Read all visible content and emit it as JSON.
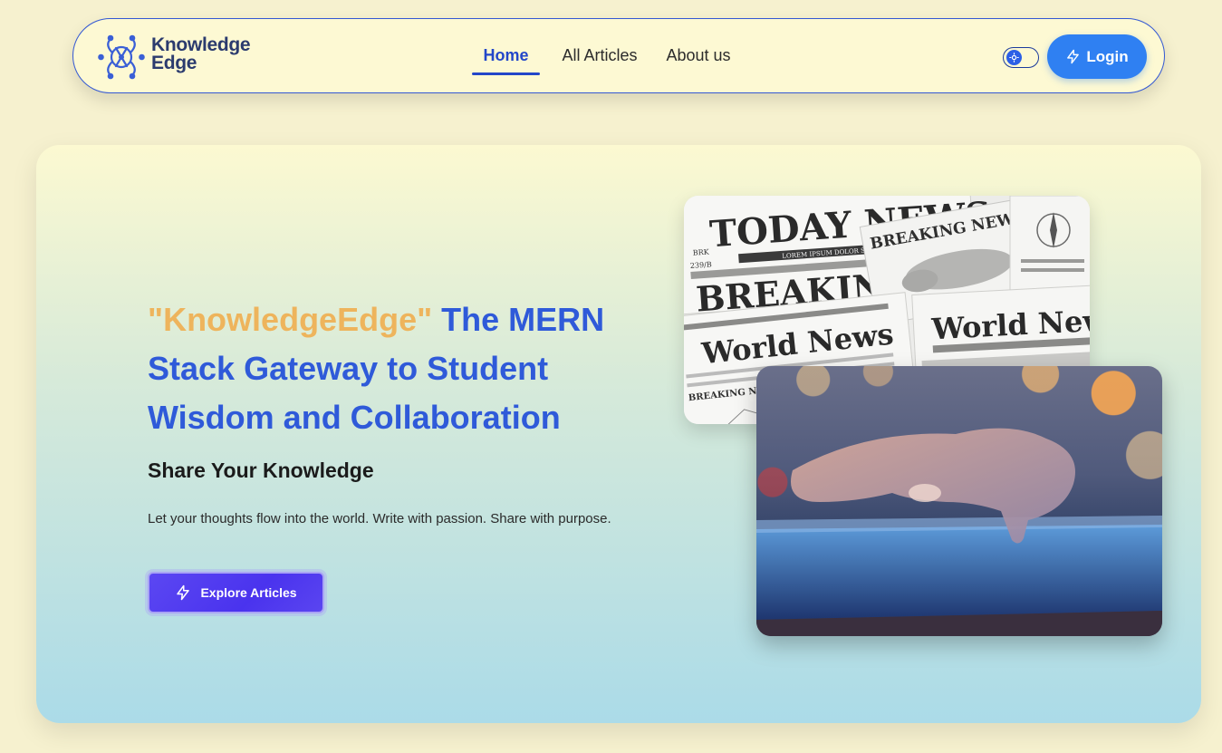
{
  "brand": {
    "line1": "Knowledge",
    "line2": "Edge",
    "logo_icon": "network-people-icon",
    "color": "#2b3b6e"
  },
  "nav": {
    "items": [
      {
        "label": "Home",
        "active": true
      },
      {
        "label": "All Articles",
        "active": false
      },
      {
        "label": "About us",
        "active": false
      }
    ],
    "active_color": "#2347c9"
  },
  "header_actions": {
    "theme_toggle_icon": "sun-icon",
    "login_label": "Login",
    "login_icon": "lightning-icon",
    "login_color": "#2f80f2"
  },
  "hero": {
    "title_brand": "\"KnowledgeEdge\"",
    "title_rest": " The MERN Stack Gateway to Student Wisdom and Collaboration",
    "subtitle": "Share Your Knowledge",
    "description": "Let your thoughts flow into the world. Write with passion. Share with purpose.",
    "cta_label": "Explore Articles",
    "cta_icon": "lightning-icon",
    "cta_color": "#4a33ee",
    "brand_color": "#eeb45c",
    "title_color": "#2f5ad9"
  },
  "news_image": {
    "headline_1": "TODAY NEWS",
    "headline_2": "BREAKING NEWS",
    "headline_3": "BREAKING",
    "headline_4": "World News",
    "headline_5": "World New",
    "caption": "LOREM IPSUM DOLOR SIT AMET",
    "tag_1": "BRK",
    "tag_2": "239/B",
    "tag_3": "BREAKING NEWS"
  }
}
